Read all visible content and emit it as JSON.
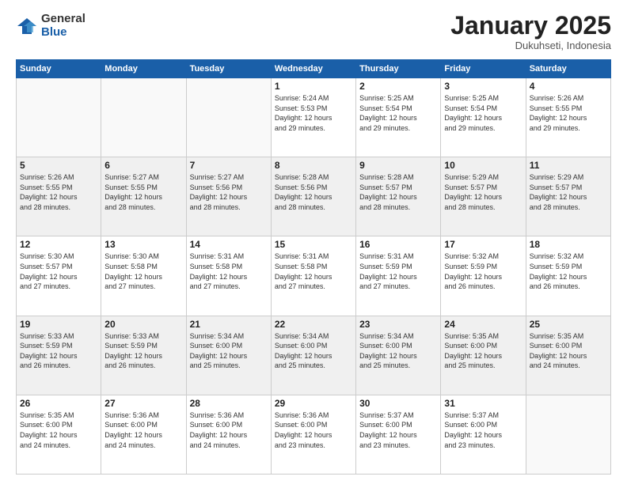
{
  "logo": {
    "general": "General",
    "blue": "Blue"
  },
  "header": {
    "month": "January 2025",
    "location": "Dukuhseti, Indonesia"
  },
  "weekdays": [
    "Sunday",
    "Monday",
    "Tuesday",
    "Wednesday",
    "Thursday",
    "Friday",
    "Saturday"
  ],
  "weeks": [
    [
      {
        "day": "",
        "info": ""
      },
      {
        "day": "",
        "info": ""
      },
      {
        "day": "",
        "info": ""
      },
      {
        "day": "1",
        "info": "Sunrise: 5:24 AM\nSunset: 5:53 PM\nDaylight: 12 hours\nand 29 minutes."
      },
      {
        "day": "2",
        "info": "Sunrise: 5:25 AM\nSunset: 5:54 PM\nDaylight: 12 hours\nand 29 minutes."
      },
      {
        "day": "3",
        "info": "Sunrise: 5:25 AM\nSunset: 5:54 PM\nDaylight: 12 hours\nand 29 minutes."
      },
      {
        "day": "4",
        "info": "Sunrise: 5:26 AM\nSunset: 5:55 PM\nDaylight: 12 hours\nand 29 minutes."
      }
    ],
    [
      {
        "day": "5",
        "info": "Sunrise: 5:26 AM\nSunset: 5:55 PM\nDaylight: 12 hours\nand 28 minutes."
      },
      {
        "day": "6",
        "info": "Sunrise: 5:27 AM\nSunset: 5:55 PM\nDaylight: 12 hours\nand 28 minutes."
      },
      {
        "day": "7",
        "info": "Sunrise: 5:27 AM\nSunset: 5:56 PM\nDaylight: 12 hours\nand 28 minutes."
      },
      {
        "day": "8",
        "info": "Sunrise: 5:28 AM\nSunset: 5:56 PM\nDaylight: 12 hours\nand 28 minutes."
      },
      {
        "day": "9",
        "info": "Sunrise: 5:28 AM\nSunset: 5:57 PM\nDaylight: 12 hours\nand 28 minutes."
      },
      {
        "day": "10",
        "info": "Sunrise: 5:29 AM\nSunset: 5:57 PM\nDaylight: 12 hours\nand 28 minutes."
      },
      {
        "day": "11",
        "info": "Sunrise: 5:29 AM\nSunset: 5:57 PM\nDaylight: 12 hours\nand 28 minutes."
      }
    ],
    [
      {
        "day": "12",
        "info": "Sunrise: 5:30 AM\nSunset: 5:57 PM\nDaylight: 12 hours\nand 27 minutes."
      },
      {
        "day": "13",
        "info": "Sunrise: 5:30 AM\nSunset: 5:58 PM\nDaylight: 12 hours\nand 27 minutes."
      },
      {
        "day": "14",
        "info": "Sunrise: 5:31 AM\nSunset: 5:58 PM\nDaylight: 12 hours\nand 27 minutes."
      },
      {
        "day": "15",
        "info": "Sunrise: 5:31 AM\nSunset: 5:58 PM\nDaylight: 12 hours\nand 27 minutes."
      },
      {
        "day": "16",
        "info": "Sunrise: 5:31 AM\nSunset: 5:59 PM\nDaylight: 12 hours\nand 27 minutes."
      },
      {
        "day": "17",
        "info": "Sunrise: 5:32 AM\nSunset: 5:59 PM\nDaylight: 12 hours\nand 26 minutes."
      },
      {
        "day": "18",
        "info": "Sunrise: 5:32 AM\nSunset: 5:59 PM\nDaylight: 12 hours\nand 26 minutes."
      }
    ],
    [
      {
        "day": "19",
        "info": "Sunrise: 5:33 AM\nSunset: 5:59 PM\nDaylight: 12 hours\nand 26 minutes."
      },
      {
        "day": "20",
        "info": "Sunrise: 5:33 AM\nSunset: 5:59 PM\nDaylight: 12 hours\nand 26 minutes."
      },
      {
        "day": "21",
        "info": "Sunrise: 5:34 AM\nSunset: 6:00 PM\nDaylight: 12 hours\nand 25 minutes."
      },
      {
        "day": "22",
        "info": "Sunrise: 5:34 AM\nSunset: 6:00 PM\nDaylight: 12 hours\nand 25 minutes."
      },
      {
        "day": "23",
        "info": "Sunrise: 5:34 AM\nSunset: 6:00 PM\nDaylight: 12 hours\nand 25 minutes."
      },
      {
        "day": "24",
        "info": "Sunrise: 5:35 AM\nSunset: 6:00 PM\nDaylight: 12 hours\nand 25 minutes."
      },
      {
        "day": "25",
        "info": "Sunrise: 5:35 AM\nSunset: 6:00 PM\nDaylight: 12 hours\nand 24 minutes."
      }
    ],
    [
      {
        "day": "26",
        "info": "Sunrise: 5:35 AM\nSunset: 6:00 PM\nDaylight: 12 hours\nand 24 minutes."
      },
      {
        "day": "27",
        "info": "Sunrise: 5:36 AM\nSunset: 6:00 PM\nDaylight: 12 hours\nand 24 minutes."
      },
      {
        "day": "28",
        "info": "Sunrise: 5:36 AM\nSunset: 6:00 PM\nDaylight: 12 hours\nand 24 minutes."
      },
      {
        "day": "29",
        "info": "Sunrise: 5:36 AM\nSunset: 6:00 PM\nDaylight: 12 hours\nand 23 minutes."
      },
      {
        "day": "30",
        "info": "Sunrise: 5:37 AM\nSunset: 6:00 PM\nDaylight: 12 hours\nand 23 minutes."
      },
      {
        "day": "31",
        "info": "Sunrise: 5:37 AM\nSunset: 6:00 PM\nDaylight: 12 hours\nand 23 minutes."
      },
      {
        "day": "",
        "info": ""
      }
    ]
  ]
}
